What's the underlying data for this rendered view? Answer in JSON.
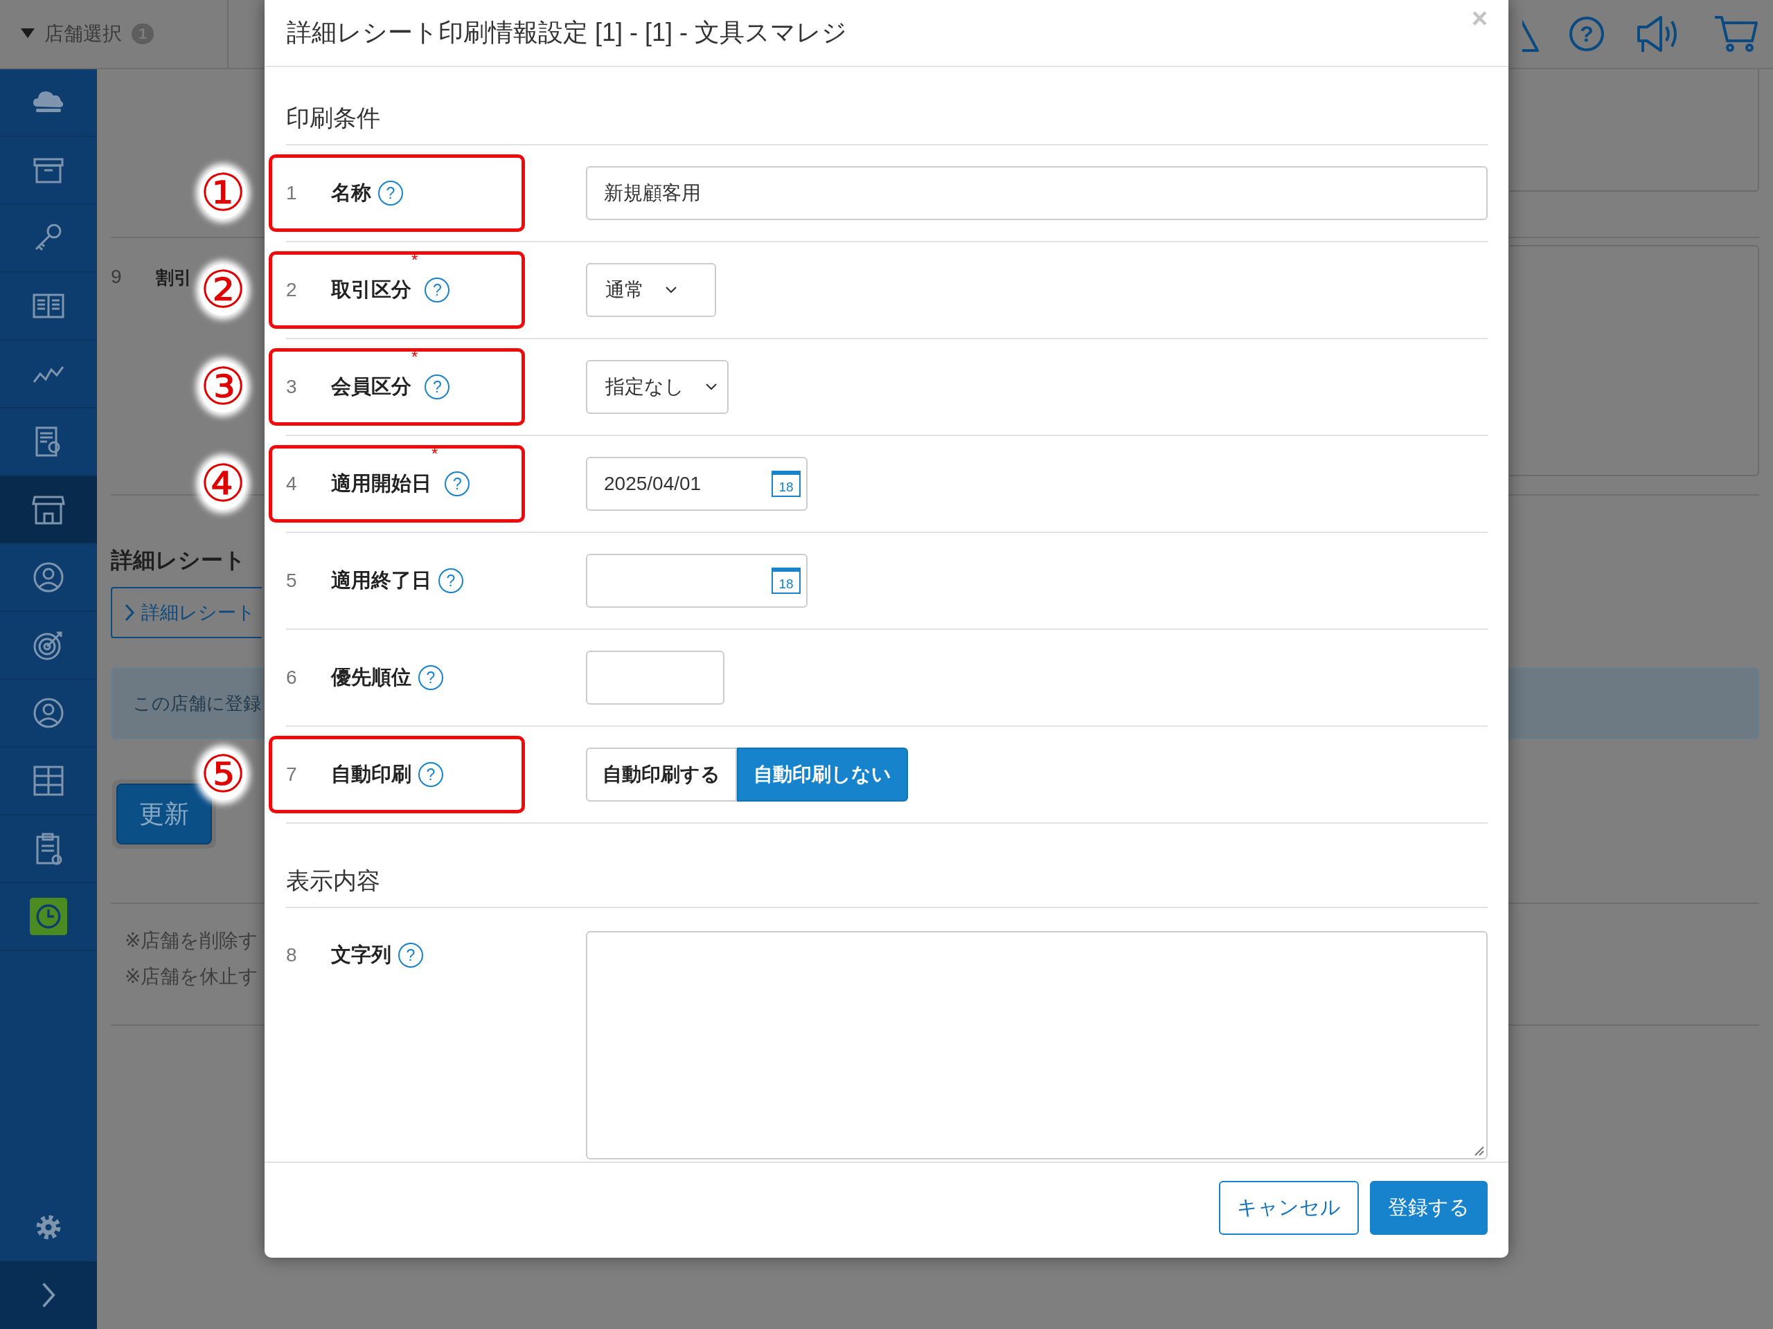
{
  "header": {
    "store_select": "店舗選択",
    "store_count": "1",
    "help_button": "?"
  },
  "sidebar": {
    "items": [
      {
        "kind": "cloud",
        "selected": false
      },
      {
        "kind": "archive",
        "selected": false
      },
      {
        "kind": "key",
        "selected": false
      },
      {
        "kind": "book",
        "selected": false
      },
      {
        "kind": "chart",
        "selected": false
      },
      {
        "kind": "report",
        "selected": false
      },
      {
        "kind": "store",
        "selected": true
      },
      {
        "kind": "person",
        "selected": false
      },
      {
        "kind": "target",
        "selected": false
      },
      {
        "kind": "person",
        "selected": false
      },
      {
        "kind": "cabinet",
        "selected": false
      },
      {
        "kind": "clipboard",
        "selected": false
      },
      {
        "kind": "clock",
        "selected": false
      }
    ],
    "bottom": [
      {
        "kind": "settings"
      },
      {
        "kind": "expand"
      }
    ]
  },
  "background": {
    "row": {
      "number": "9",
      "label": "割引"
    },
    "heading": "詳細レシート",
    "link": "詳細レシート",
    "notice": "この店舗に登録",
    "update_button": "更新",
    "notes": [
      "※店舗を削除す",
      "※店舗を休止す"
    ]
  },
  "modal": {
    "title": "詳細レシート印刷情報設定 [1] - [1] - 文具スマレジ",
    "close": "×",
    "sections": [
      {
        "heading": "印刷条件",
        "rows": [
          {
            "number": "1",
            "label": "名称",
            "help": "?",
            "highlighted": true,
            "marker": "①",
            "field": {
              "kind": "text",
              "value": "新規顧客用"
            }
          },
          {
            "number": "2",
            "label": "取引区分",
            "required_mark": "*",
            "help": "?",
            "highlighted": true,
            "marker": "②",
            "field": {
              "kind": "select",
              "value": "通常"
            }
          },
          {
            "number": "3",
            "label": "会員区分",
            "required_mark": "*",
            "help": "?",
            "highlighted": true,
            "marker": "③",
            "field": {
              "kind": "select",
              "value": "指定なし"
            }
          },
          {
            "number": "4",
            "label": "適用開始日",
            "required_mark": "*",
            "help": "?",
            "highlighted": true,
            "marker": "④",
            "field": {
              "kind": "date",
              "value": "2025/04/01",
              "calendar": "18"
            }
          },
          {
            "number": "5",
            "label": "適用終了日",
            "help": "?",
            "highlighted": false,
            "field": {
              "kind": "date",
              "calendar": "18"
            }
          },
          {
            "number": "6",
            "label": "優先順位",
            "help": "?",
            "highlighted": false,
            "field": {
              "kind": "number"
            }
          },
          {
            "number": "7",
            "label": "自動印刷",
            "help": "?",
            "highlighted": true,
            "marker": "⑤",
            "field": {
              "kind": "toggle",
              "options": [
                {
                  "label": "自動印刷する",
                  "selected": false
                },
                {
                  "label": "自動印刷しない",
                  "selected": true
                }
              ]
            }
          }
        ]
      },
      {
        "heading": "表示内容",
        "rows": [
          {
            "number": "8",
            "label": "文字列",
            "help": "?",
            "highlighted": false,
            "field": {
              "kind": "textarea"
            }
          }
        ]
      }
    ],
    "buttons": [
      {
        "label": "キャンセル",
        "kind": "secondary"
      },
      {
        "label": "登録する",
        "kind": "primary"
      }
    ]
  }
}
